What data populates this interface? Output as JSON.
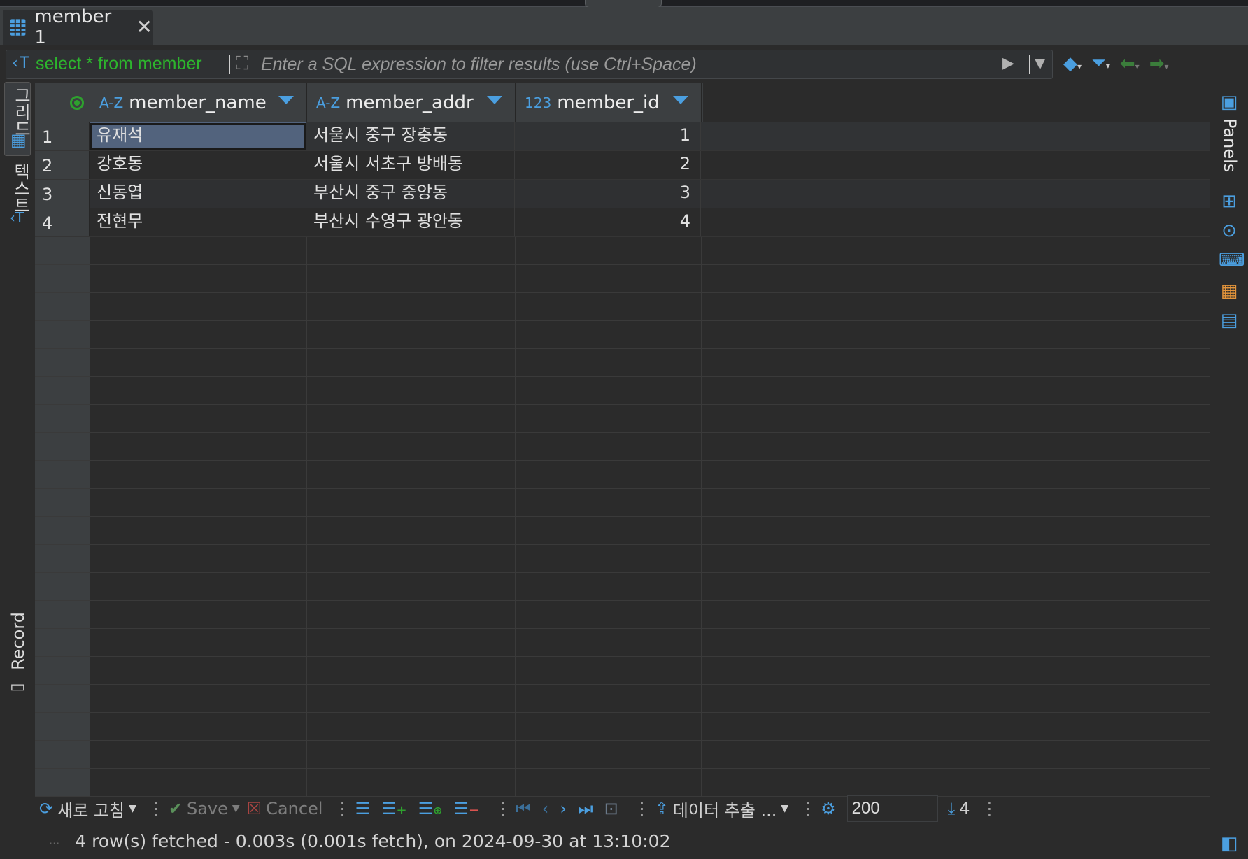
{
  "tab": {
    "title": "member 1",
    "close_glyph": "✕",
    "icon": "table-grid-icon"
  },
  "filter": {
    "query": "select * from member",
    "placeholder": "Enter a SQL expression to filter results (use Ctrl+Space)",
    "query_icon": "sql-query-icon"
  },
  "left_rail": {
    "grid_tab": "그리드",
    "text_tab": "텍스트",
    "record_tab": "Record"
  },
  "right_rail": {
    "panels_label": "Panels"
  },
  "columns": [
    {
      "type_icon": "A-Z",
      "name": "member_name"
    },
    {
      "type_icon": "A-Z",
      "name": "member_addr"
    },
    {
      "type_icon": "123",
      "name": "member_id"
    }
  ],
  "rows": [
    {
      "num": "1",
      "member_name": "유재석",
      "member_addr": "서울시 중구 장충동",
      "member_id": "1"
    },
    {
      "num": "2",
      "member_name": "강호동",
      "member_addr": "서울시 서초구 방배동",
      "member_id": "2"
    },
    {
      "num": "3",
      "member_name": "신동엽",
      "member_addr": "부산시 중구 중앙동",
      "member_id": "3"
    },
    {
      "num": "4",
      "member_name": "전현무",
      "member_addr": "부산시 수영구 광안동",
      "member_id": "4"
    }
  ],
  "toolbar": {
    "refresh": "새로 고침",
    "save": "Save",
    "cancel": "Cancel",
    "export": "데이터 추출 ...",
    "fetch_size": "200",
    "row_count": "4"
  },
  "status": {
    "message": "4 row(s) fetched - 0.003s (0.001s fetch), on 2024-09-30 at 13:10:02"
  },
  "colors": {
    "accent": "#4b9fe0",
    "query_green": "#2db52d",
    "selected_cell": "#52637d"
  }
}
